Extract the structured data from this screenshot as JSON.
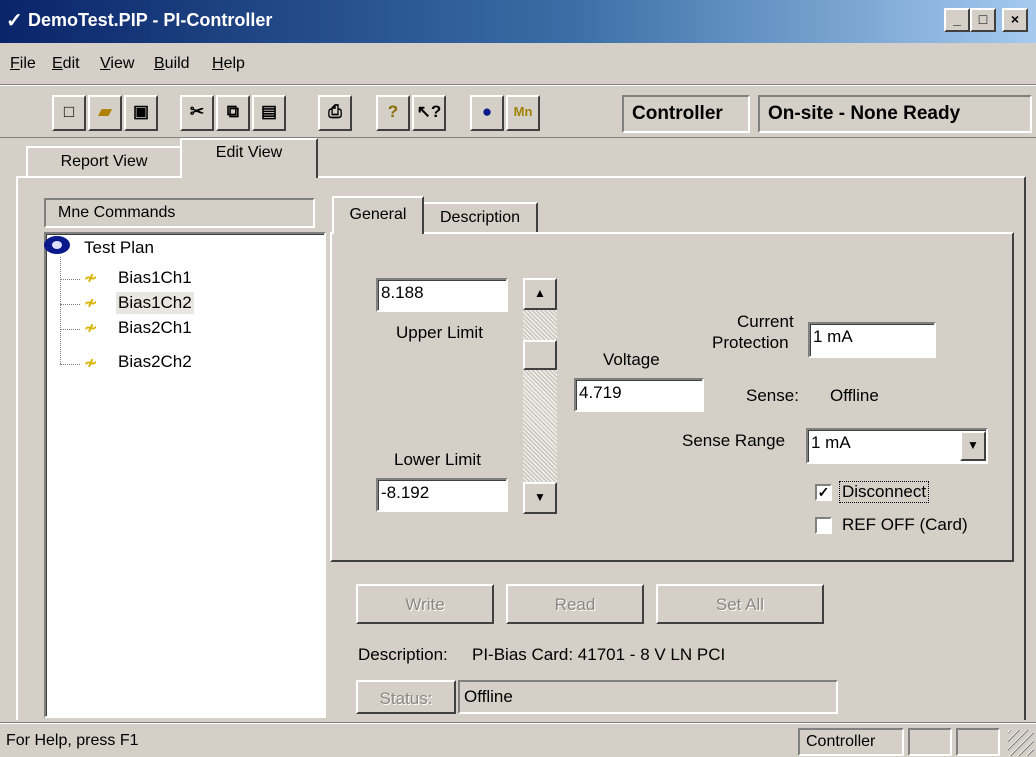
{
  "window": {
    "title": "DemoTest.PIP - PI-Controller",
    "controls": {
      "minimize": "_",
      "maximize": "□",
      "close": "×"
    }
  },
  "menu": [
    "File",
    "Edit",
    "View",
    "Build",
    "Help"
  ],
  "toolbar": {
    "buttons": [
      "new-file-icon",
      "open-folder-icon",
      "save-icon",
      "cut-icon",
      "copy-icon",
      "paste-icon",
      "print-icon",
      "help-icon",
      "context-help-icon",
      "view-eye-icon",
      "mne-icon"
    ],
    "mne_label": "Mn",
    "mode_label": "Controller",
    "status_label": "On-site - None Ready"
  },
  "tabs": {
    "report": "Report View",
    "edit": "Edit View"
  },
  "tree": {
    "header": "Mne Commands",
    "root": "Test Plan",
    "items": [
      "Bias1Ch1",
      "Bias1Ch2",
      "Bias2Ch1",
      "Bias2Ch2"
    ],
    "selected": "Bias1Ch2"
  },
  "inner_tabs": {
    "general": "General",
    "description": "Description"
  },
  "form": {
    "upper_limit_value": "8.188",
    "upper_limit_label": "Upper Limit",
    "lower_limit_label": "Lower Limit",
    "lower_limit_value": "-8.192",
    "voltage_label": "Voltage",
    "voltage_value": "4.719",
    "voltage_slider_fraction": 0.79,
    "current_label_1": "Current",
    "current_label_2": "Protection",
    "current_value": "1 mA",
    "sense_label": "Sense:",
    "sense_value": "Offline",
    "sense_range_label": "Sense Range",
    "sense_range_value": "1 mA",
    "disconnect_label": "Disconnect",
    "disconnect_checked": true,
    "ref_off_label": "REF OFF (Card)",
    "ref_off_checked": false
  },
  "buttons": {
    "write": "Write",
    "read": "Read",
    "set_all": "Set All",
    "status": "Status:"
  },
  "description_label": "Description:",
  "description_value": "PI-Bias Card: 41701 - 8 V LN PCI",
  "status_value": "Offline",
  "statusbar": {
    "help": "For Help, press F1",
    "mode": "Controller"
  },
  "colors": {
    "title_start": "#0a246a",
    "title_end": "#a6caf0",
    "face": "#d4d0c8"
  }
}
